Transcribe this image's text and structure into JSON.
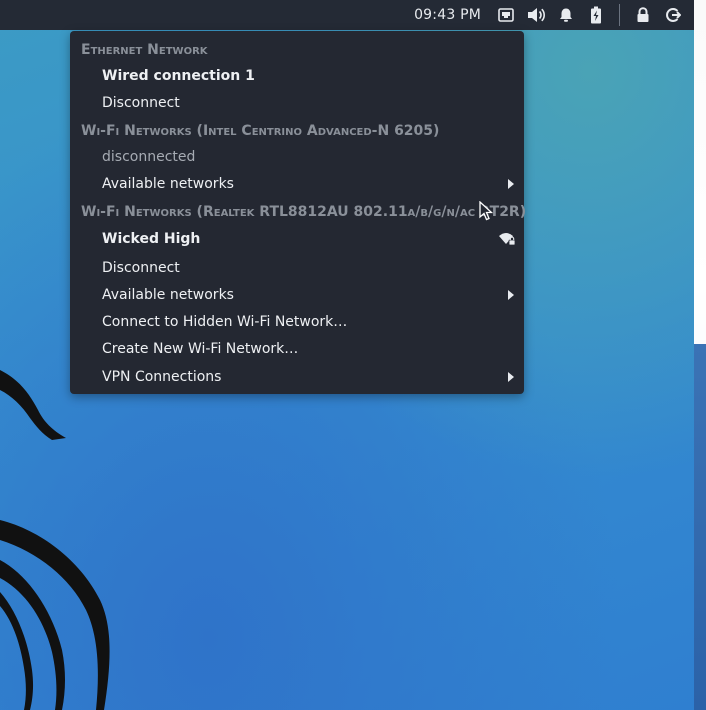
{
  "panel": {
    "clock": "09:43 PM",
    "icons": [
      "network-wired-icon",
      "volume-icon",
      "notifications-bell-icon",
      "battery-charging-icon",
      "lock-icon",
      "logout-icon"
    ]
  },
  "menu": {
    "ethernet_header": "Ethernet Network",
    "wired_connection": "Wired connection 1",
    "ethernet_disconnect": "Disconnect",
    "wifi1_header": "Wi-Fi Networks (Intel Centrino Advanced-N 6205)",
    "wifi1_status": "disconnected",
    "wifi1_available": "Available networks",
    "wifi2_header": "Wi-Fi Networks (Realtek RTL8812AU 802.11a/b/g/n/ac 2T2R)",
    "wifi2_connected": "Wicked High",
    "wifi2_disconnect": "Disconnect",
    "wifi2_available": "Available networks",
    "connect_hidden": "Connect to Hidden Wi-Fi Network…",
    "create_new": "Create New Wi-Fi Network…",
    "vpn": "VPN Connections"
  },
  "colors": {
    "panel_bg": "#242a35",
    "menu_bg": "#242832",
    "header_text": "#8a9099",
    "desktop_blue": "#3690cf"
  }
}
